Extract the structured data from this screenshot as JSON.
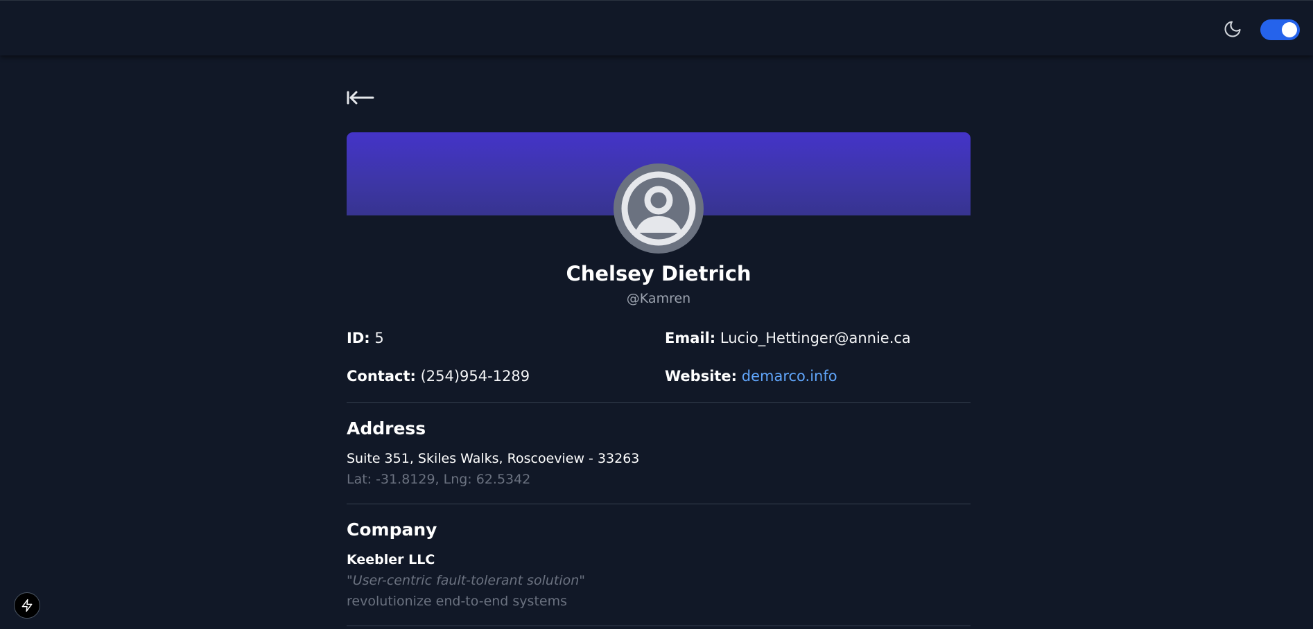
{
  "header": {
    "theme_icon": "moon-icon",
    "dark_mode_on": true,
    "toggle_color": "#2563eb"
  },
  "nav": {
    "back_icon": "arrow-left-to-line-icon"
  },
  "profile": {
    "banner_colors": [
      "#4434c8",
      "#373490"
    ],
    "avatar_icon": "user-circle-icon",
    "name": "Chelsey Dietrich",
    "username": "@Kamren"
  },
  "details": {
    "id_label": "ID:",
    "id_value": "5",
    "email_label": "Email:",
    "email_value": "Lucio_Hettinger@annie.ca",
    "contact_label": "Contact:",
    "contact_value": "(254)954-1289",
    "website_label": "Website:",
    "website_value": "demarco.info",
    "link_color": "#60a5fa"
  },
  "address": {
    "title": "Address",
    "street_line": "Suite 351, Skiles Walks, Roscoeview - 33263",
    "geo_line": "Lat: -31.8129, Lng: 62.5342"
  },
  "company": {
    "title": "Company",
    "name": "Keebler LLC",
    "catch_phrase": "\"User-centric fault-tolerant solution\"",
    "bs": "revolutionize end-to-end systems"
  },
  "floating_button": {
    "icon": "lightning-bolt-icon"
  }
}
